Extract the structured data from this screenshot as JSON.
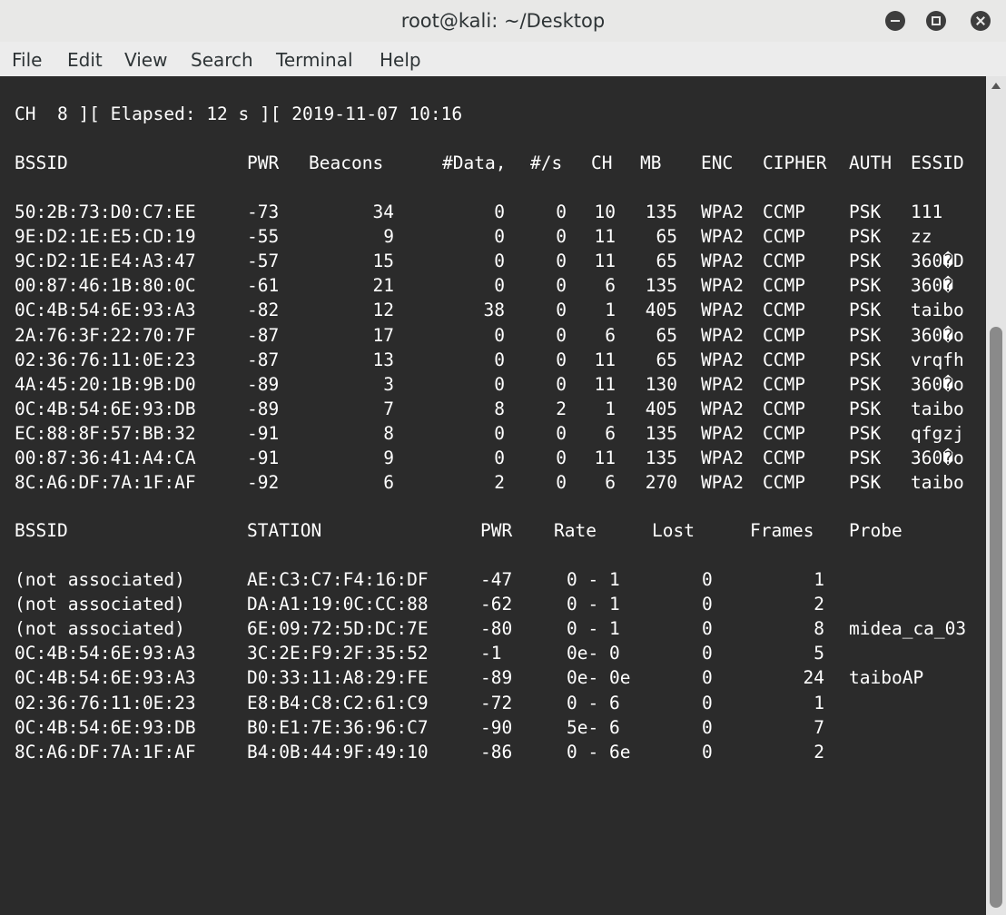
{
  "window": {
    "title": "root@kali: ~/Desktop"
  },
  "menu": [
    "File",
    "Edit",
    "View",
    "Search",
    "Terminal",
    "Help"
  ],
  "status_line": "CH  8 ][ Elapsed: 12 s ][ 2019-11-07 10:16",
  "ap_table": {
    "headers": [
      "BSSID",
      "PWR",
      "Beacons",
      "#Data,",
      "#/s",
      "CH",
      "MB",
      "ENC",
      "CIPHER",
      "AUTH",
      "ESSID"
    ],
    "rows": [
      [
        "50:2B:73:D0:C7:EE",
        "-73",
        "34",
        "0",
        "0",
        "10",
        "135",
        "WPA2",
        "CCMP",
        "PSK",
        "111"
      ],
      [
        "9E:D2:1E:E5:CD:19",
        "-55",
        "9",
        "0",
        "0",
        "11",
        "65",
        "WPA2",
        "CCMP",
        "PSK",
        "zz"
      ],
      [
        "9C:D2:1E:E4:A3:47",
        "-57",
        "15",
        "0",
        "0",
        "11",
        "65",
        "WPA2",
        "CCMP",
        "PSK",
        "360�D"
      ],
      [
        "00:87:46:1B:80:0C",
        "-61",
        "21",
        "0",
        "0",
        "6",
        "135",
        "WPA2",
        "CCMP",
        "PSK",
        "360�"
      ],
      [
        "0C:4B:54:6E:93:A3",
        "-82",
        "12",
        "38",
        "0",
        "1",
        "405",
        "WPA2",
        "CCMP",
        "PSK",
        "taibo"
      ],
      [
        "2A:76:3F:22:70:7F",
        "-87",
        "17",
        "0",
        "0",
        "6",
        "65",
        "WPA2",
        "CCMP",
        "PSK",
        "360�o"
      ],
      [
        "02:36:76:11:0E:23",
        "-87",
        "13",
        "0",
        "0",
        "11",
        "65",
        "WPA2",
        "CCMP",
        "PSK",
        "vrqfh"
      ],
      [
        "4A:45:20:1B:9B:D0",
        "-89",
        "3",
        "0",
        "0",
        "11",
        "130",
        "WPA2",
        "CCMP",
        "PSK",
        "360�o"
      ],
      [
        "0C:4B:54:6E:93:DB",
        "-89",
        "7",
        "8",
        "2",
        "1",
        "405",
        "WPA2",
        "CCMP",
        "PSK",
        "taibo"
      ],
      [
        "EC:88:8F:57:BB:32",
        "-91",
        "8",
        "0",
        "0",
        "6",
        "135",
        "WPA2",
        "CCMP",
        "PSK",
        "qfgzj"
      ],
      [
        "00:87:36:41:A4:CA",
        "-91",
        "9",
        "0",
        "0",
        "11",
        "135",
        "WPA2",
        "CCMP",
        "PSK",
        "360�o"
      ],
      [
        "8C:A6:DF:7A:1F:AF",
        "-92",
        "6",
        "2",
        "0",
        "6",
        "270",
        "WPA2",
        "CCMP",
        "PSK",
        "taibo"
      ]
    ]
  },
  "station_table": {
    "headers": [
      "BSSID",
      "STATION",
      "PWR",
      "Rate",
      "Lost",
      "Frames",
      "Probe"
    ],
    "rows": [
      [
        "(not associated)",
        "AE:C3:C7:F4:16:DF",
        "-47",
        "0 - 1",
        "0",
        "1",
        ""
      ],
      [
        "(not associated)",
        "DA:A1:19:0C:CC:88",
        "-62",
        "0 - 1",
        "0",
        "2",
        ""
      ],
      [
        "(not associated)",
        "6E:09:72:5D:DC:7E",
        "-80",
        "0 - 1",
        "0",
        "8",
        "midea_ca_03"
      ],
      [
        "0C:4B:54:6E:93:A3",
        "3C:2E:F9:2F:35:52",
        "-1",
        "0e- 0",
        "0",
        "5",
        ""
      ],
      [
        "0C:4B:54:6E:93:A3",
        "D0:33:11:A8:29:FE",
        "-89",
        "0e- 0e",
        "0",
        "24",
        "taiboAP"
      ],
      [
        "02:36:76:11:0E:23",
        "E8:B4:C8:C2:61:C9",
        "-72",
        "0 - 6",
        "0",
        "1",
        ""
      ],
      [
        "0C:4B:54:6E:93:DB",
        "B0:E1:7E:36:96:C7",
        "-90",
        "5e- 6",
        "0",
        "7",
        ""
      ],
      [
        "8C:A6:DF:7A:1F:AF",
        "B4:0B:44:9F:49:10",
        "-86",
        "0 - 6e",
        "0",
        "2",
        ""
      ]
    ]
  }
}
